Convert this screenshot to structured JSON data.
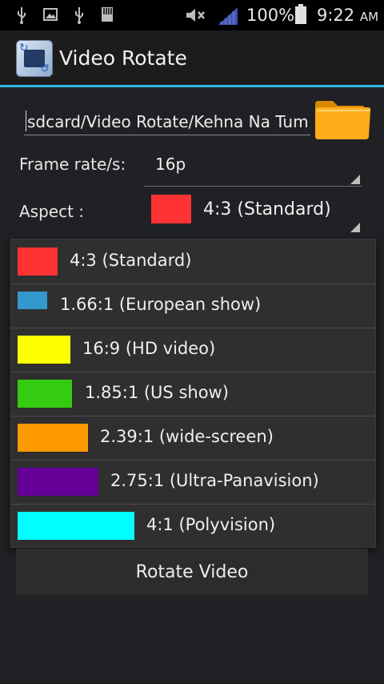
{
  "status_bar": {
    "battery": "100%",
    "time": "9:22",
    "ampm": "AM",
    "icons": [
      "usb-icon",
      "image-icon",
      "usb-icon",
      "sdcard-icon",
      "mute-icon",
      "signal-icon",
      "battery-icon"
    ]
  },
  "app": {
    "title": "Video Rotate",
    "accent": "#33b5e5"
  },
  "form": {
    "path_value": "sdcard/Video Rotate/Kehna Na Tum",
    "frame_rate_label": "Frame rate/s:",
    "frame_rate_value": "16p",
    "aspect_label": "Aspect :",
    "aspect_selected": "4:3 (Standard)",
    "aspect_selected_color": "#ff3333"
  },
  "aspect_options": [
    {
      "label": "4:3 (Standard)",
      "color": "#ff3333"
    },
    {
      "label": "1.66:1 (European show)",
      "color": "#3399cc"
    },
    {
      "label": "16:9 (HD video)",
      "color": "#ffff00"
    },
    {
      "label": "1.85:1 (US show)",
      "color": "#33cc11"
    },
    {
      "label": "2.39:1 (wide-screen)",
      "color": "#ff9900"
    },
    {
      "label": "2.75:1 (Ultra-Panavision)",
      "color": "#660099"
    },
    {
      "label": "4:1 (Polyvision)",
      "color": "#00ffff"
    }
  ],
  "actions": {
    "rotate_label": "Rotate Video"
  }
}
